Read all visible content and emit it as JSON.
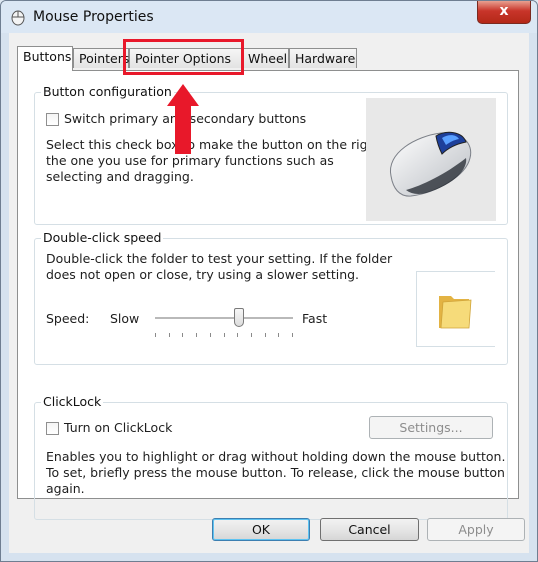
{
  "window": {
    "title": "Mouse Properties",
    "close_label": "x"
  },
  "tabs": [
    {
      "label": "Buttons"
    },
    {
      "label": "Pointers"
    },
    {
      "label": "Pointer Options"
    },
    {
      "label": "Wheel"
    },
    {
      "label": "Hardware"
    }
  ],
  "button_configuration": {
    "title": "Button configuration",
    "switch_label": "Switch primary and secondary buttons",
    "description_lines": [
      "Select this check box to make the button on the right",
      "the one you use for primary functions such as",
      "selecting and dragging."
    ]
  },
  "double_click": {
    "title": "Double-click speed",
    "description_lines": [
      "Double-click the folder to test your setting. If the folder",
      "does not open or close, try using a slower setting."
    ],
    "speed_label": "Speed:",
    "slow_label": "Slow",
    "fast_label": "Fast",
    "speed_value": 0.62
  },
  "clicklock": {
    "title": "ClickLock",
    "turn_on_label": "Turn on ClickLock",
    "settings_label": "Settings...",
    "description_lines": [
      "Enables you to highlight or drag without holding down the mouse button.",
      "To set, briefly press the mouse button. To release, click the mouse button",
      "again."
    ]
  },
  "footer": {
    "ok_label": "OK",
    "cancel_label": "Cancel",
    "apply_label": "Apply"
  },
  "annotation_color": "#e8182a"
}
